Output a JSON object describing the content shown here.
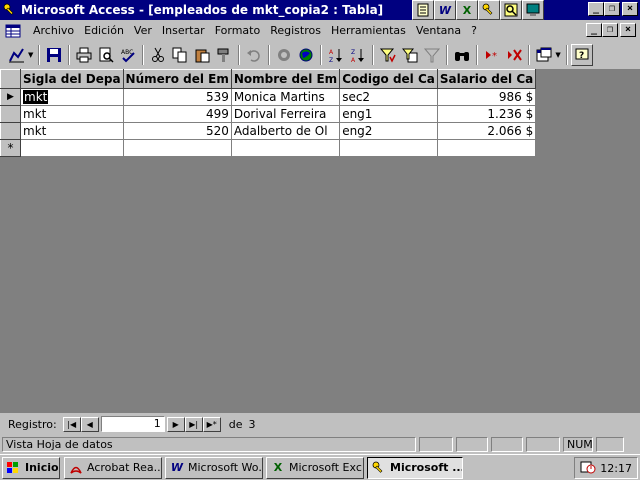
{
  "window": {
    "title": "Microsoft Access - [empleados de mkt_copia2 : Tabla]",
    "minimize_glyph": "_",
    "maximize_glyph": "²",
    "close_glyph": "×"
  },
  "tray_shortcuts": [
    {
      "label": "",
      "icon": "notepad-icon"
    },
    {
      "label": "W",
      "icon": "word-icon"
    },
    {
      "label": "X",
      "icon": "excel-icon"
    },
    {
      "label": "",
      "icon": "access-key-icon"
    },
    {
      "label": "",
      "icon": "search-icon"
    },
    {
      "label": "",
      "icon": "monitor-icon"
    }
  ],
  "menu": {
    "items": [
      "Archivo",
      "Edición",
      "Ver",
      "Insertar",
      "Formato",
      "Registros",
      "Herramientas",
      "Ventana",
      "?"
    ]
  },
  "table": {
    "columns": [
      "Sigla del Depa",
      "Número del Em",
      "Nombre del Em",
      "Codigo del Ca",
      "Salario del Ca"
    ],
    "rows": [
      [
        "mkt",
        "539",
        "Monica Martins",
        "sec2",
        "986 $"
      ],
      [
        "mkt",
        "499",
        "Dorival Ferreira",
        "eng1",
        "1.236 $"
      ],
      [
        "mkt",
        "520",
        "Adalberto de Ol",
        "eng2",
        "2.066 $"
      ]
    ],
    "new_row_marker": "*",
    "current_row_marker": "▶"
  },
  "navigator": {
    "label": "Registro:",
    "current": "1",
    "of_label": "de",
    "total": "3"
  },
  "status": {
    "text": "Vista Hoja de datos",
    "num_indicator": "NUM"
  },
  "taskbar": {
    "start_label": "Inicio",
    "tasks": [
      {
        "label": "Acrobat Rea...",
        "active": false
      },
      {
        "label": "Microsoft Wo...",
        "active": false
      },
      {
        "label": "Microsoft Exc...",
        "active": false
      },
      {
        "label": "Microsoft ...",
        "active": true
      }
    ],
    "clock": "12:17"
  }
}
